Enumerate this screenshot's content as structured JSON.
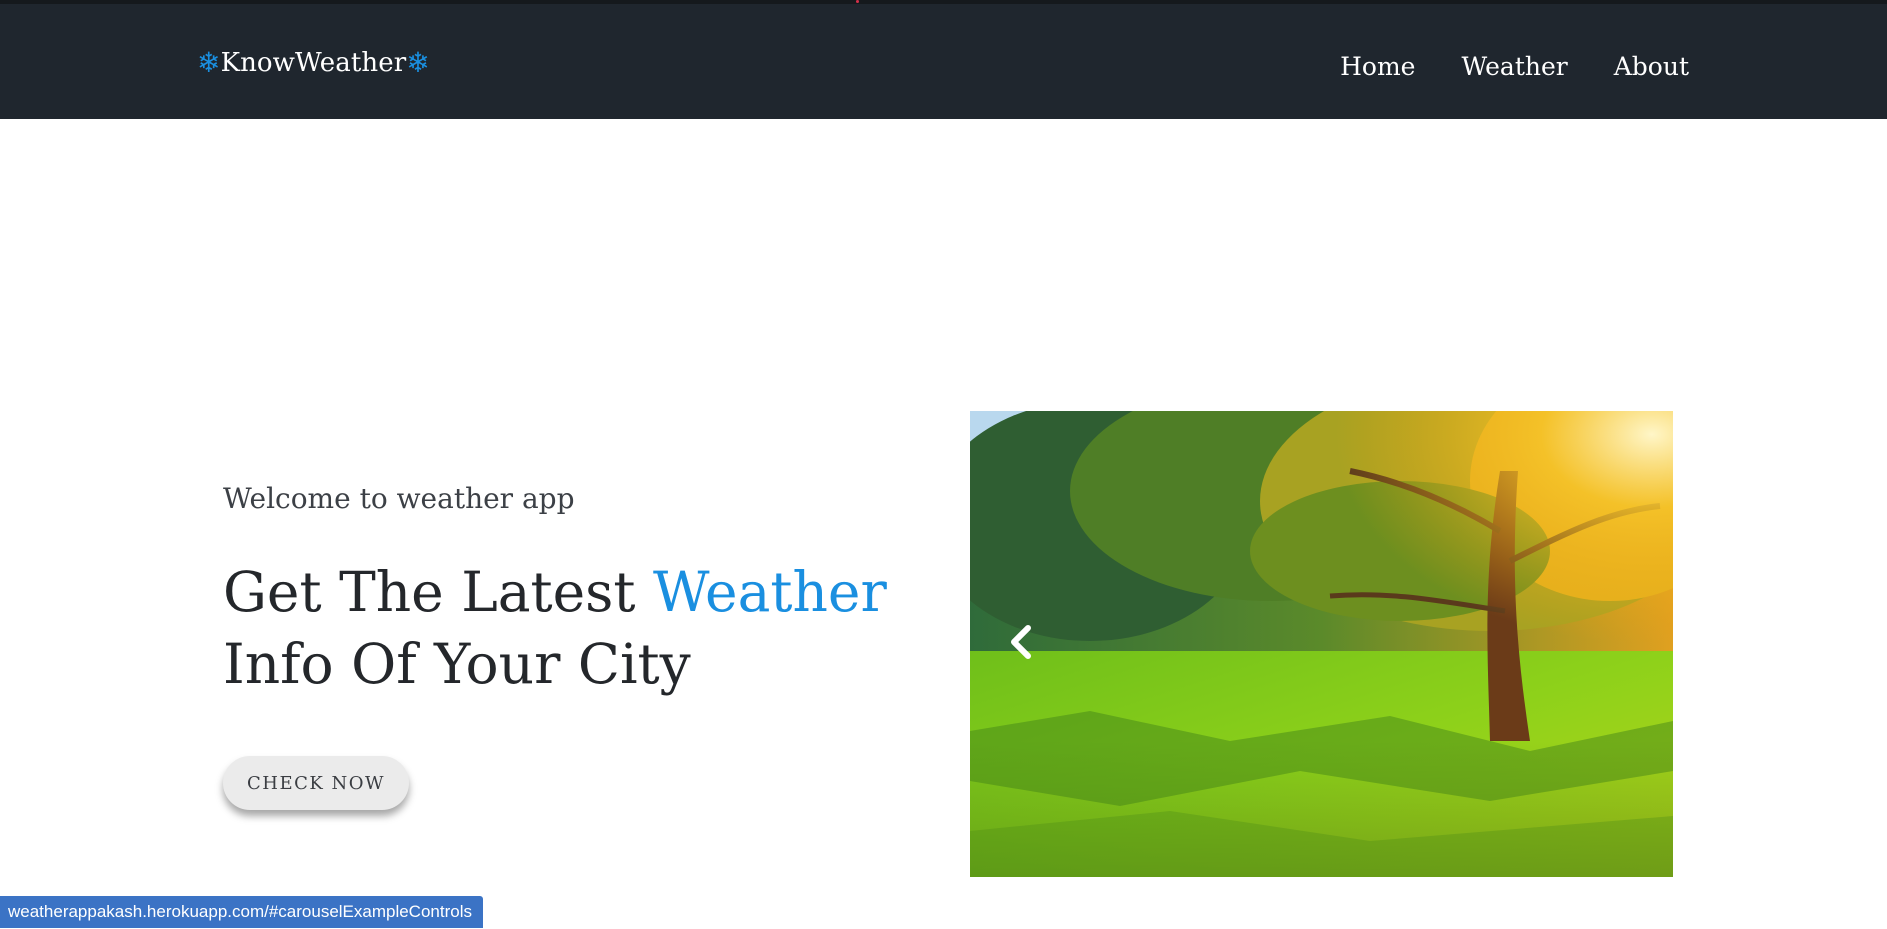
{
  "navbar": {
    "brand": "KnowWeather",
    "brand_icon": "❄",
    "links": [
      "Home",
      "Weather",
      "About"
    ]
  },
  "hero": {
    "subtitle": "Welcome to weather app",
    "title_part1": "Get The Latest ",
    "title_accent": "Weather",
    "title_part2": "Info Of Your City",
    "button_label": "CHECK NOW"
  },
  "carousel": {
    "image": "sunny-park-with-autumn-tree",
    "prev_icon": "chevron-left-icon"
  },
  "status_bar": {
    "url": "weatherappakash.herokuapp.com/#carouselExampleControls"
  },
  "colors": {
    "navbar_bg": "#1f262e",
    "accent": "#1a8fe0",
    "status_bg": "#3b73c5"
  }
}
